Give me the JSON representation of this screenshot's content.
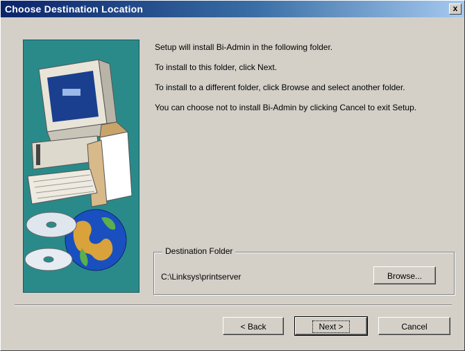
{
  "window": {
    "title": "Choose Destination Location",
    "close_label": "x"
  },
  "content": {
    "paragraphs": [
      "Setup will install Bi-Admin in the following folder.",
      "To install to this folder, click Next.",
      "To install to a different folder, click Browse and select another folder.",
      "You can choose not to install Bi-Admin by clicking Cancel to exit Setup."
    ]
  },
  "destination": {
    "group_label": "Destination Folder",
    "path": "C:\\Linksys\\printserver",
    "browse_label": "Browse..."
  },
  "buttons": {
    "back_label": "< Back",
    "next_label": "Next >",
    "cancel_label": "Cancel"
  },
  "colors": {
    "title_start": "#0a246a",
    "title_end": "#a6caf0",
    "panel_bg": "#2a8a8a",
    "dialog_bg": "#d4d0c8"
  },
  "illustration": {
    "icon": "computer-with-globe-and-disks"
  }
}
